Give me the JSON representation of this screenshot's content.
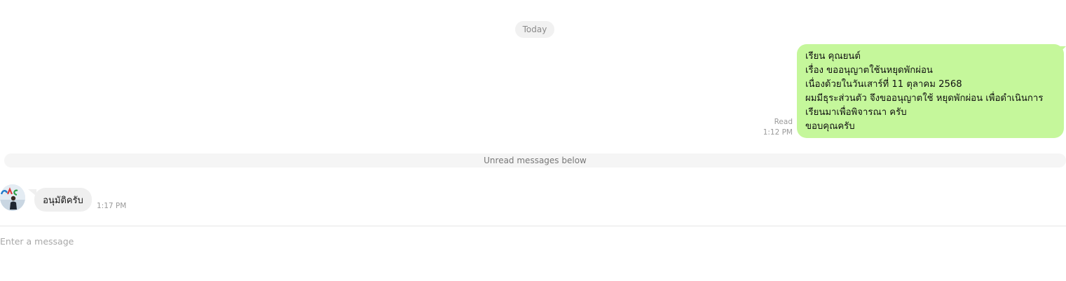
{
  "date_separator": "Today",
  "outgoing_message": {
    "lines": [
      "เรียน คุณยนต์",
      "เรื่อง ขออนุญาตใช้นหยุดพักผ่อน",
      "เนื่องด้วยในวันเสาร์ที่ 11 ตุลาคม 2568",
      "ผมมีธุระส่วนตัว จึงขออนุญาตใช้ หยุดพักผ่อน เพื่อดำเนินการ",
      "เรียนมาเพื่อพิจารณา ครับ",
      "ขอบคุณครับ"
    ],
    "status": "Read",
    "time": "1:12 PM"
  },
  "unread_divider": "Unread messages below",
  "incoming_message": {
    "text": "อนุมัติครับ",
    "time": "1:17 PM"
  },
  "composer": {
    "placeholder": "Enter a message"
  },
  "colors": {
    "outgoing_bubble": "#c5f79b",
    "incoming_bubble": "#efefef",
    "meta_text": "#9a9a9a"
  }
}
